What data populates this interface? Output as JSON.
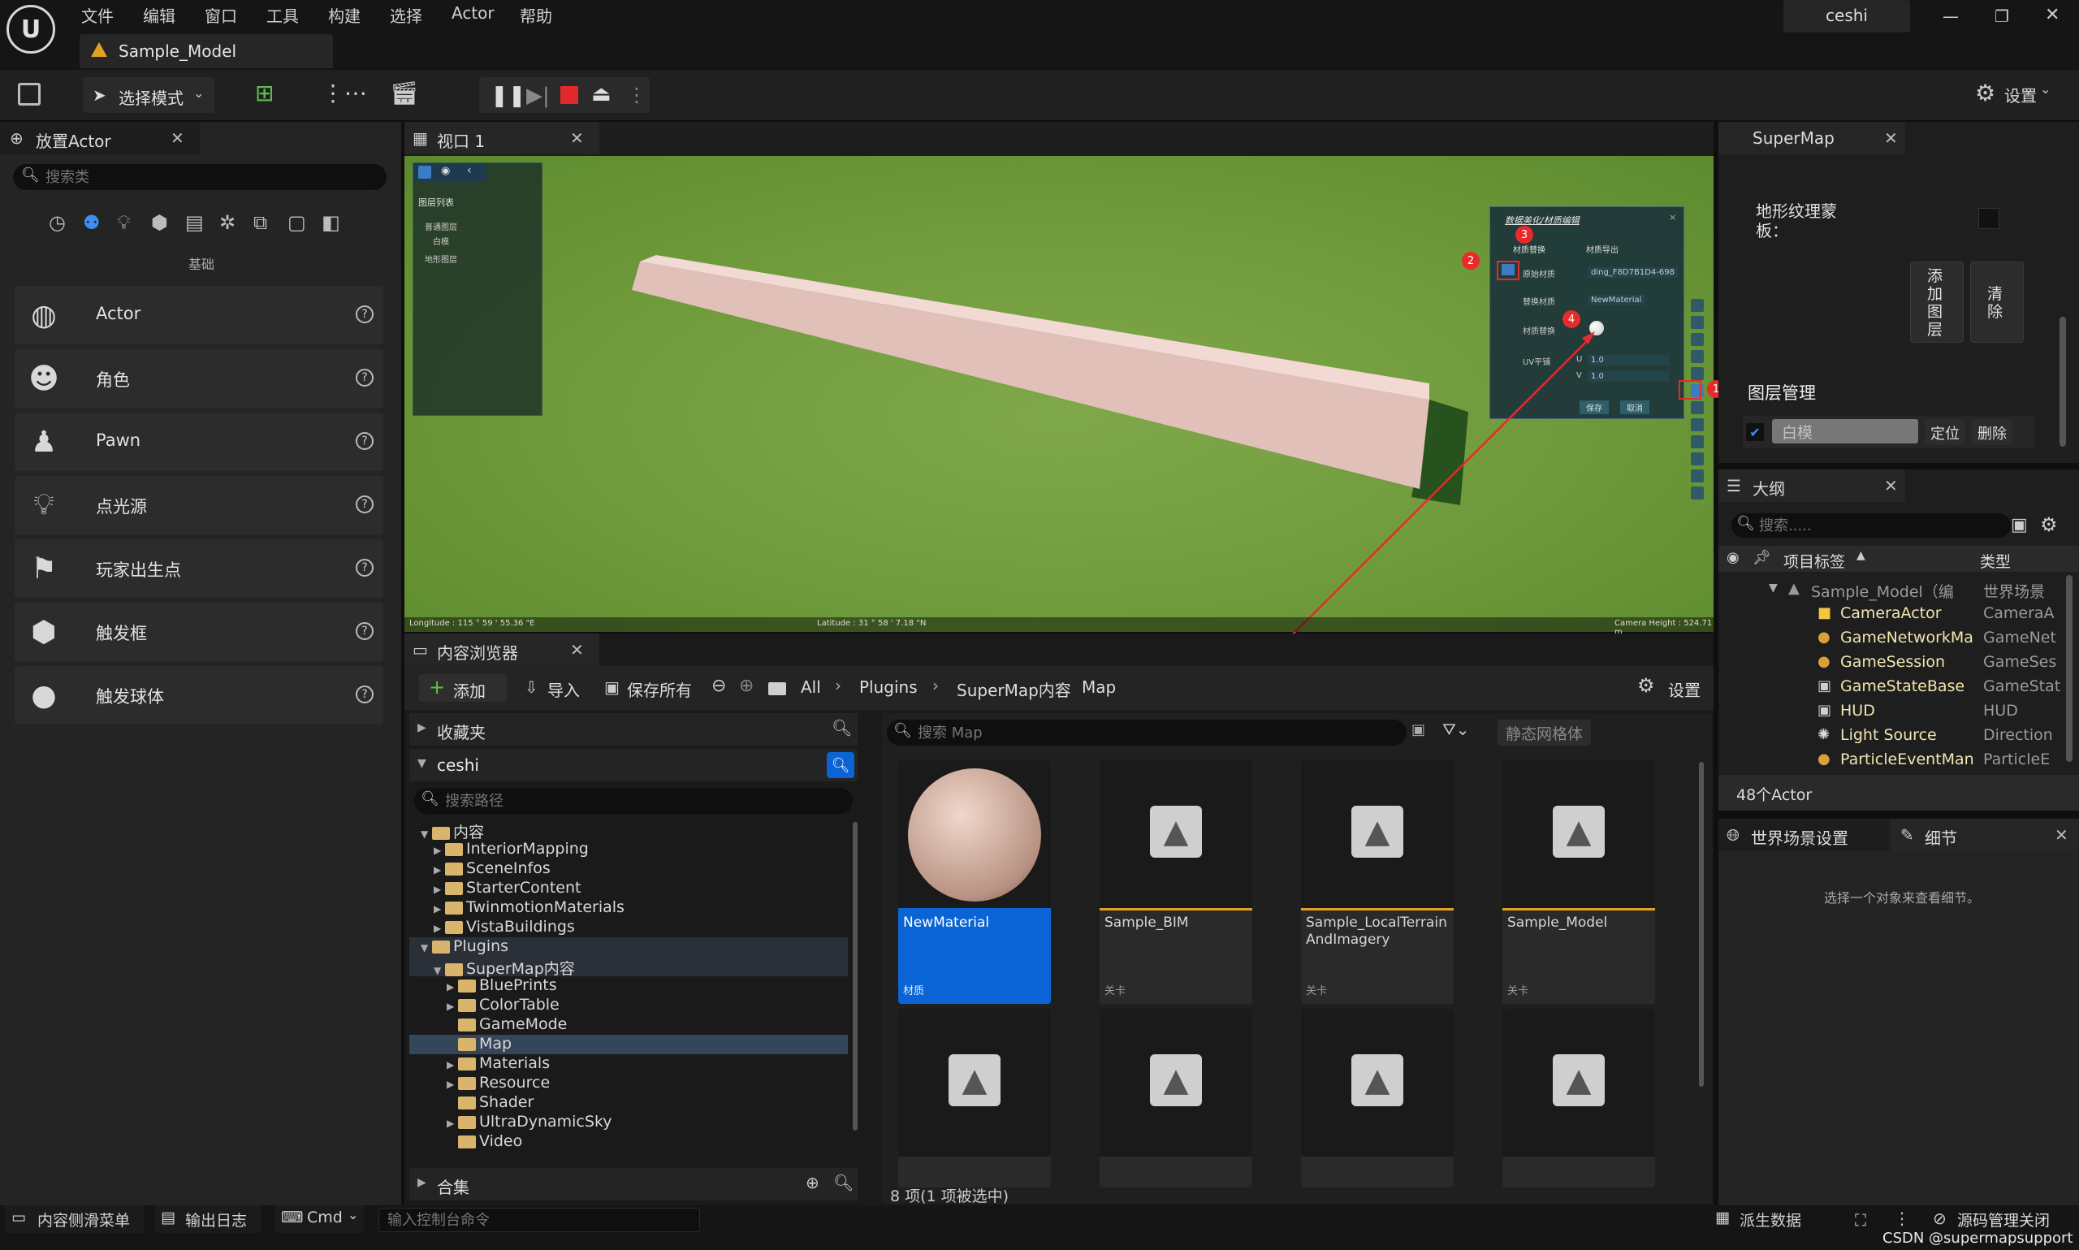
{
  "menu": [
    "文件",
    "编辑",
    "窗口",
    "工具",
    "构建",
    "选择",
    "Actor",
    "帮助"
  ],
  "user": "ceshi",
  "doc_tab": "Sample_Model",
  "toolbar": {
    "mode": "选择模式",
    "settings": "设置"
  },
  "place_actor": {
    "tab": "放置Actor",
    "search_placeholder": "搜索类",
    "category": "基础",
    "items": [
      "Actor",
      "角色",
      "Pawn",
      "点光源",
      "玩家出生点",
      "触发框",
      "触发球体"
    ]
  },
  "viewport": {
    "tab": "视口 1",
    "layer_panel": {
      "title": "图层列表",
      "rows": [
        "普通图层",
        "白模",
        "地形图层"
      ]
    },
    "material_dialog": {
      "title": "数据美化/材质编辑",
      "tabs": [
        "材质替换",
        "材质导出"
      ],
      "rows": [
        {
          "label": "原始材质",
          "value": "ding_F8D7B1D4-698"
        },
        {
          "label": "替换材质",
          "value": "NewMaterial"
        },
        {
          "label": "材质替换",
          "value": ""
        },
        {
          "label": "UV平铺",
          "u": "U",
          "u_val": "1.0",
          "v": "V",
          "v_val": "1.0"
        }
      ],
      "save": "保存",
      "cancel": "取消"
    },
    "markers": [
      "1",
      "2",
      "3",
      "4"
    ],
    "status": {
      "longitude": "Longitude : 115 ° 59 ' 55.36 \"E",
      "latitude": "Latitude : 31 ° 58 ' 7.18 \"N",
      "height": "Camera Height : 524.71 m"
    }
  },
  "content_browser": {
    "tab": "内容浏览器",
    "add": "添加",
    "import": "导入",
    "save_all": "保存所有",
    "breadcrumb": [
      "All",
      "Plugins",
      "SuperMap内容",
      "Map"
    ],
    "settings": "设置",
    "favorites": "收藏夹",
    "project": "ceshi",
    "path_placeholder": "搜索路径",
    "tree": [
      {
        "label": "内容",
        "level": 0,
        "open": true
      },
      {
        "label": "InteriorMapping",
        "level": 1
      },
      {
        "label": "SceneInfos",
        "level": 1
      },
      {
        "label": "StarterContent",
        "level": 1
      },
      {
        "label": "TwinmotionMaterials",
        "level": 1
      },
      {
        "label": "VistaBuildings",
        "level": 1
      },
      {
        "label": "Plugins",
        "level": 0,
        "open": true
      },
      {
        "label": "SuperMap内容",
        "level": 1,
        "open": true
      },
      {
        "label": "BluePrints",
        "level": 2
      },
      {
        "label": "ColorTable",
        "level": 2
      },
      {
        "label": "GameMode",
        "level": 2
      },
      {
        "label": "Map",
        "level": 2
      },
      {
        "label": "Materials",
        "level": 2
      },
      {
        "label": "Resource",
        "level": 2
      },
      {
        "label": "Shader",
        "level": 2
      },
      {
        "label": "UltraDynamicSky",
        "level": 2
      },
      {
        "label": "Video",
        "level": 2
      }
    ],
    "collections": "合集",
    "search_placeholder": "搜索 Map",
    "filter_tag": "静态网格体",
    "assets": [
      {
        "name": "NewMaterial",
        "kind": "材质"
      },
      {
        "name": "Sample_BIM",
        "kind": "关卡"
      },
      {
        "name": "Sample_LocalTerrainAndImagery",
        "kind": "关卡"
      },
      {
        "name": "Sample_Model",
        "kind": "关卡"
      }
    ],
    "count": "8 项(1 项被选中)"
  },
  "supermap": {
    "tab": "SuperMap",
    "terrain_mask": "地形纹理蒙板：",
    "add_layer": "添加图层",
    "clear": "清除",
    "layer_mgmt": "图层管理",
    "layer_name": "白模",
    "locate": "定位",
    "delete": "删除"
  },
  "outliner": {
    "tab": "大纲",
    "search_placeholder": "搜索.....",
    "col_label": "项目标签",
    "col_type": "类型",
    "rows": [
      {
        "name": "Sample_Model（编",
        "type": "世界场景"
      },
      {
        "name": "CameraActor",
        "type": "CameraA"
      },
      {
        "name": "GameNetworkMan",
        "type": "GameNet"
      },
      {
        "name": "GameSession",
        "type": "GameSes"
      },
      {
        "name": "GameStateBase",
        "type": "GameStat"
      },
      {
        "name": "HUD",
        "type": "HUD"
      },
      {
        "name": "Light Source",
        "type": "Direction"
      },
      {
        "name": "ParticleEventMan",
        "type": "ParticleE"
      }
    ],
    "count": "48个Actor"
  },
  "details": {
    "tab1": "世界场景设置",
    "tab2": "细节",
    "hint": "选择一个对象来查看细节。"
  },
  "statusbar": {
    "drawer": "内容侧滑菜单",
    "log": "输出日志",
    "cmd": "Cmd",
    "console_placeholder": "输入控制台命令",
    "derived": "派生数据",
    "scm": "源码管理关闭"
  },
  "watermark": "CSDN @supermapsupport"
}
